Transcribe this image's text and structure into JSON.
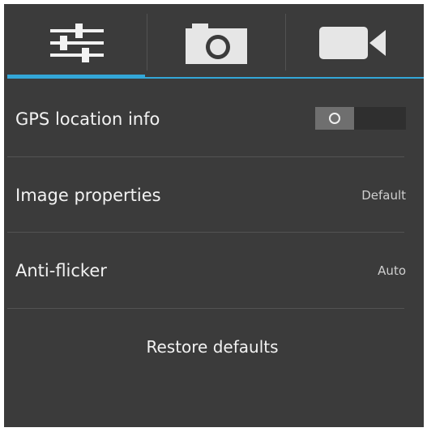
{
  "tabs": [
    {
      "icon": "settings-sliders-icon",
      "selected": true
    },
    {
      "icon": "camera-icon",
      "selected": false
    },
    {
      "icon": "video-camera-icon",
      "selected": false
    }
  ],
  "settings": {
    "gps": {
      "label": "GPS location info",
      "toggle": "off"
    },
    "image_properties": {
      "label": "Image properties",
      "value": "Default"
    },
    "anti_flicker": {
      "label": "Anti-flicker",
      "value": "Auto"
    }
  },
  "restore_label": "Restore defaults",
  "colors": {
    "background": "#3b3b3b",
    "accent": "#33a7d8",
    "text": "#f2f2f2"
  }
}
